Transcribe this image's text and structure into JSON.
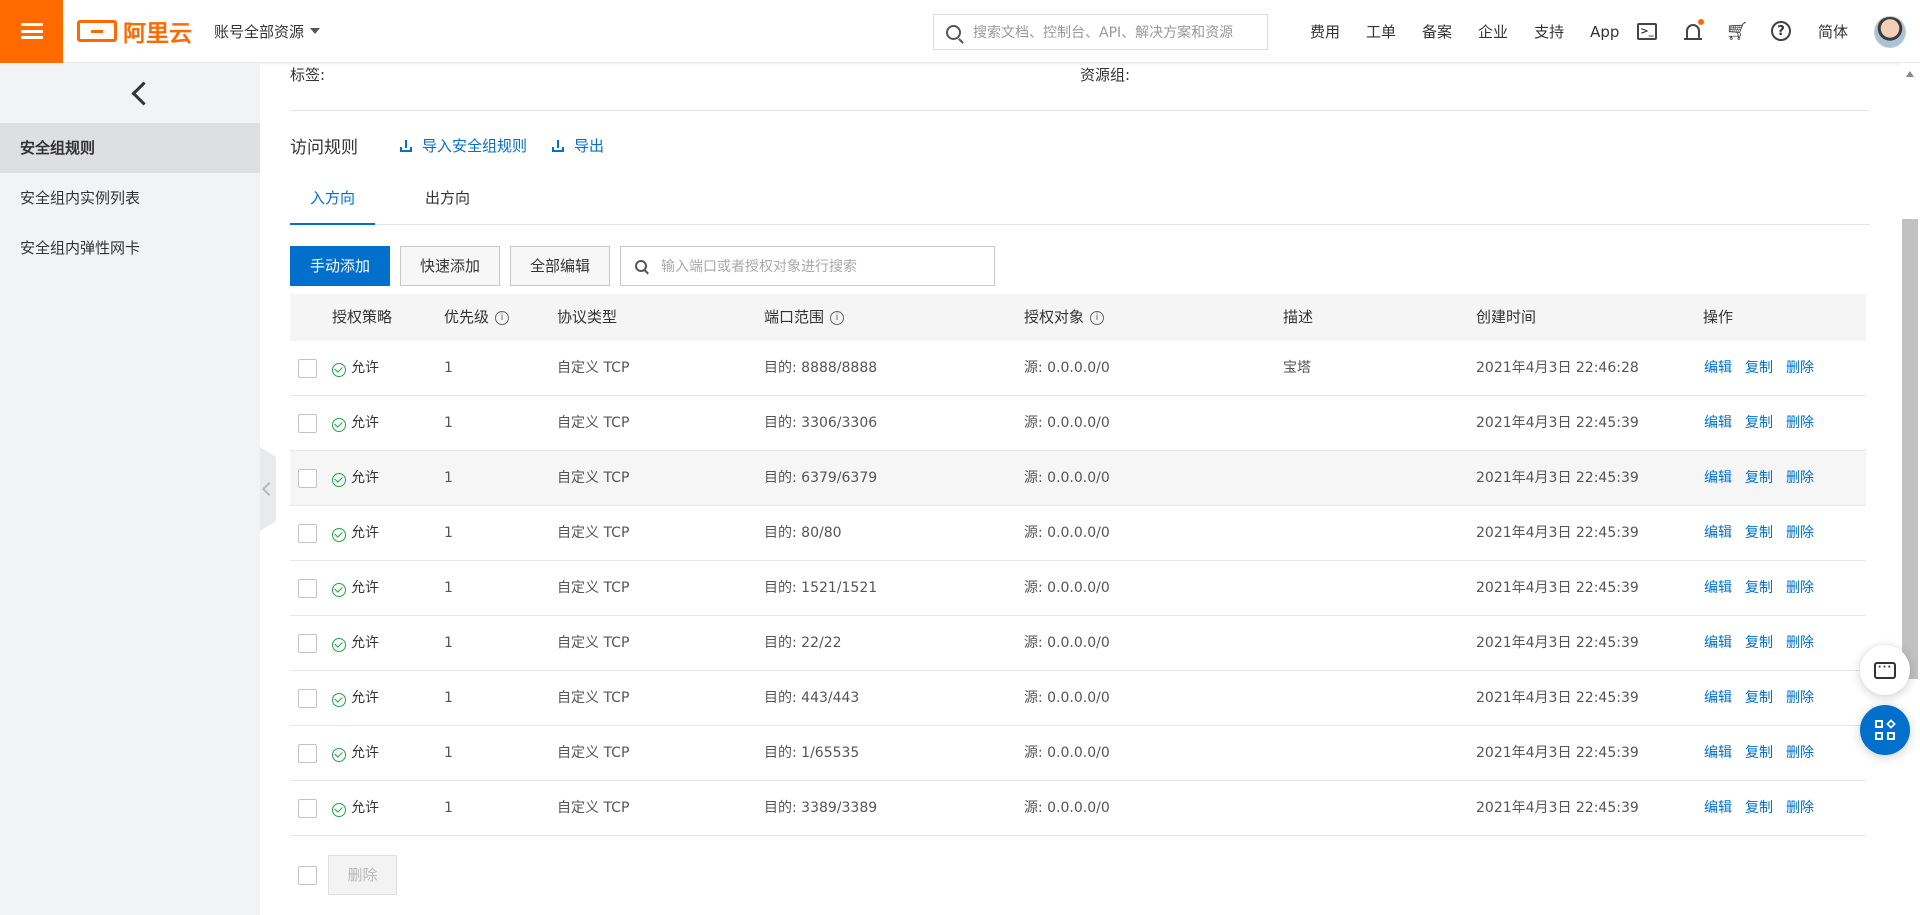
{
  "header": {
    "brand": "阿里云",
    "account_menu": "账号全部资源",
    "search_placeholder": "搜索文档、控制台、API、解决方案和资源",
    "nav": [
      "费用",
      "工单",
      "备案",
      "企业",
      "支持",
      "App"
    ],
    "lang": "简体",
    "accent_color": "#ff6a00",
    "icons": [
      "menu-icon",
      "terminal-icon",
      "bell-icon",
      "cart-icon",
      "help-icon",
      "avatar"
    ]
  },
  "sidebar": {
    "items": [
      {
        "label": "安全组规则",
        "active": true
      },
      {
        "label": "安全组内实例列表",
        "active": false
      },
      {
        "label": "安全组内弹性网卡",
        "active": false
      }
    ]
  },
  "main": {
    "tags_label": "标签:",
    "resource_group_label": "资源组:",
    "section_title": "访问规则",
    "import_link": "导入安全组规则",
    "export_link": "导出",
    "tabs": [
      {
        "label": "入方向",
        "active": true
      },
      {
        "label": "出方向",
        "active": false
      }
    ],
    "buttons": {
      "manual_add": "手动添加",
      "quick_add": "快速添加",
      "edit_all": "全部编辑"
    },
    "filter_placeholder": "输入端口或者授权对象进行搜索",
    "columns": [
      "授权策略",
      "优先级",
      "协议类型",
      "端口范围",
      "授权对象",
      "描述",
      "创建时间",
      "操作"
    ],
    "info_mark": "i",
    "row_actions": [
      "编辑",
      "复制",
      "删除"
    ],
    "rows": [
      {
        "policy": "允许",
        "priority": "1",
        "protocol": "自定义 TCP",
        "port": "目的: 8888/8888",
        "source": "源: 0.0.0.0/0",
        "desc": "宝塔",
        "created": "2021年4月3日 22:46:28"
      },
      {
        "policy": "允许",
        "priority": "1",
        "protocol": "自定义 TCP",
        "port": "目的: 3306/3306",
        "source": "源: 0.0.0.0/0",
        "desc": "",
        "created": "2021年4月3日 22:45:39"
      },
      {
        "policy": "允许",
        "priority": "1",
        "protocol": "自定义 TCP",
        "port": "目的: 6379/6379",
        "source": "源: 0.0.0.0/0",
        "desc": "",
        "created": "2021年4月3日 22:45:39"
      },
      {
        "policy": "允许",
        "priority": "1",
        "protocol": "自定义 TCP",
        "port": "目的: 80/80",
        "source": "源: 0.0.0.0/0",
        "desc": "",
        "created": "2021年4月3日 22:45:39"
      },
      {
        "policy": "允许",
        "priority": "1",
        "protocol": "自定义 TCP",
        "port": "目的: 1521/1521",
        "source": "源: 0.0.0.0/0",
        "desc": "",
        "created": "2021年4月3日 22:45:39"
      },
      {
        "policy": "允许",
        "priority": "1",
        "protocol": "自定义 TCP",
        "port": "目的: 22/22",
        "source": "源: 0.0.0.0/0",
        "desc": "",
        "created": "2021年4月3日 22:45:39"
      },
      {
        "policy": "允许",
        "priority": "1",
        "protocol": "自定义 TCP",
        "port": "目的: 443/443",
        "source": "源: 0.0.0.0/0",
        "desc": "",
        "created": "2021年4月3日 22:45:39"
      },
      {
        "policy": "允许",
        "priority": "1",
        "protocol": "自定义 TCP",
        "port": "目的: 1/65535",
        "source": "源: 0.0.0.0/0",
        "desc": "",
        "created": "2021年4月3日 22:45:39"
      },
      {
        "policy": "允许",
        "priority": "1",
        "protocol": "自定义 TCP",
        "port": "目的: 3389/3389",
        "source": "源: 0.0.0.0/0",
        "desc": "",
        "created": "2021年4月3日 22:45:39"
      }
    ],
    "bulk_delete": "删除"
  }
}
